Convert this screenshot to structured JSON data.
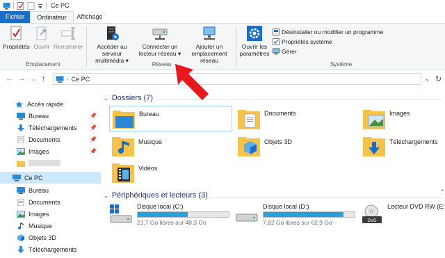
{
  "window": {
    "title": "Ce PC"
  },
  "tabs": {
    "file": "Fichier",
    "computer": "Ordinateur",
    "view": "Affichage"
  },
  "ribbon": {
    "groups": {
      "location": "Emplacement",
      "network": "Réseau",
      "system": "Système"
    },
    "properties": "Propriétés",
    "open": "Ouvrir",
    "rename": "Renommer",
    "media_server_l1": "Accéder au serveur",
    "media_server_l2": "multimédia",
    "map_drive_l1": "Connecter un",
    "map_drive_l2": "lecteur réseau",
    "add_location_l1": "Ajouter un",
    "add_location_l2": "emplacement réseau",
    "settings_l1": "Ouvrir les",
    "settings_l2": "paramètres",
    "uninstall": "Désinstaller ou modifier un programme",
    "system_properties": "Propriétés système",
    "manage": "Gérer"
  },
  "address": {
    "location": "Ce PC"
  },
  "sidebar": {
    "quick_access": "Accès rapide",
    "quick_items": [
      "Bureau",
      "Téléchargements",
      "Documents",
      "Images"
    ],
    "this_pc": "Ce PC",
    "pc_items": [
      "Bureau",
      "Documents",
      "Images",
      "Musique",
      "Objets 3D",
      "Téléchargements"
    ]
  },
  "content": {
    "folders_header": "Dossiers (7)",
    "folders": [
      "Bureau",
      "Documents",
      "Images",
      "Musique",
      "Objets 3D",
      "Téléchargements",
      "Vidéos"
    ],
    "devices_header": "Périphériques et lecteurs (3)",
    "drives": [
      {
        "name": "Disque local (C:)",
        "free": "21,7 Go libres sur 48,3 Go",
        "used_fraction": 0.55
      },
      {
        "name": "Disque local (D:)",
        "free": "7,82 Go libres sur 62,9 Go",
        "used_fraction": 0.88
      },
      {
        "name": "Lecteur DVD RW (E:)"
      }
    ]
  },
  "colors": {
    "accent": "#1a6ec9",
    "selection": "#cce8ff",
    "arrow": "#e8191e",
    "drive_bar": "#26a0da",
    "folder": "#f5c24c"
  }
}
